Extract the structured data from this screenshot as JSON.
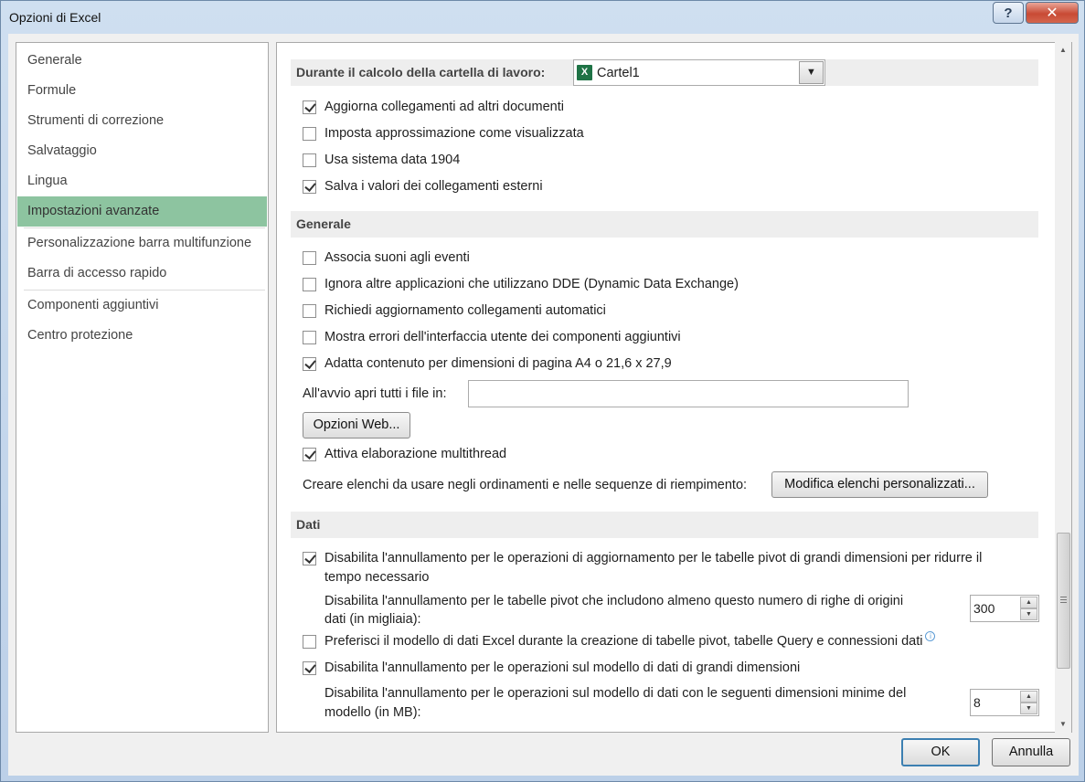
{
  "window": {
    "title": "Opzioni di Excel",
    "help_label": "?",
    "close_label": "✕"
  },
  "nav": {
    "items": [
      "Generale",
      "Formule",
      "Strumenti di correzione",
      "Salvataggio",
      "Lingua",
      "Impostazioni avanzate",
      "Personalizzazione barra multifunzione",
      "Barra di accesso rapido",
      "Componenti aggiuntivi",
      "Centro protezione"
    ],
    "selected": "Impostazioni avanzate"
  },
  "workbook_calc": {
    "header": "Durante il calcolo della cartella di lavoro:",
    "workbook_value": "Cartel1",
    "workbook_icon": "excel-workbook-icon",
    "options": [
      {
        "label": "Aggiorna collegamenti ad altri documenti",
        "checked": true
      },
      {
        "label": "Imposta approssimazione come visualizzata",
        "checked": false
      },
      {
        "label": "Usa sistema data 1904",
        "checked": false
      },
      {
        "label": "Salva i valori dei collegamenti esterni",
        "checked": true
      }
    ]
  },
  "general": {
    "header": "Generale",
    "options": [
      {
        "label": "Associa suoni agli eventi",
        "checked": false
      },
      {
        "label": "Ignora altre applicazioni che utilizzano DDE (Dynamic Data Exchange)",
        "checked": false
      },
      {
        "label": "Richiedi aggiornamento collegamenti automatici",
        "checked": false
      },
      {
        "label": "Mostra errori dell'interfaccia utente dei componenti aggiuntivi",
        "checked": false
      },
      {
        "label": "Adatta contenuto per dimensioni di pagina A4 o 21,6 x 27,9",
        "checked": true
      }
    ],
    "startup_label": "All'avvio apri tutti i file in:",
    "startup_value": "",
    "web_options_button": "Opzioni Web...",
    "multithread": {
      "label": "Attiva elaborazione multithread",
      "checked": true
    },
    "custom_lists_label": "Creare elenchi da usare negli ordinamenti e nelle sequenze di riempimento:",
    "custom_lists_button": "Modifica elenchi personalizzati..."
  },
  "data": {
    "header": "Dati",
    "pivot_undo": {
      "line1": "Disabilita l'annullamento per le operazioni di aggiornamento per le tabelle pivot di grandi dimensioni per ridurre il",
      "line2": "tempo necessario",
      "checked": true
    },
    "pivot_rows": {
      "line1": "Disabilita l'annullamento per le tabelle pivot che includono almeno questo numero di righe di origini",
      "line2": "dati (in migliaia):",
      "value": "300"
    },
    "prefer_model": {
      "label": "Preferisci il modello di dati Excel durante la creazione di tabelle pivot, tabelle Query e connessioni dati",
      "checked": false,
      "info_icon": "info-icon"
    },
    "model_undo": {
      "label": "Disabilita l'annullamento per le operazioni sul modello di dati di grandi dimensioni",
      "checked": true
    },
    "model_size": {
      "line1": "Disabilita l'annullamento per le operazioni sul modello di dati con le seguenti dimensioni minime del",
      "line2": "modello (in MB):",
      "value": "8"
    }
  },
  "footer": {
    "ok": "OK",
    "cancel": "Annulla"
  }
}
